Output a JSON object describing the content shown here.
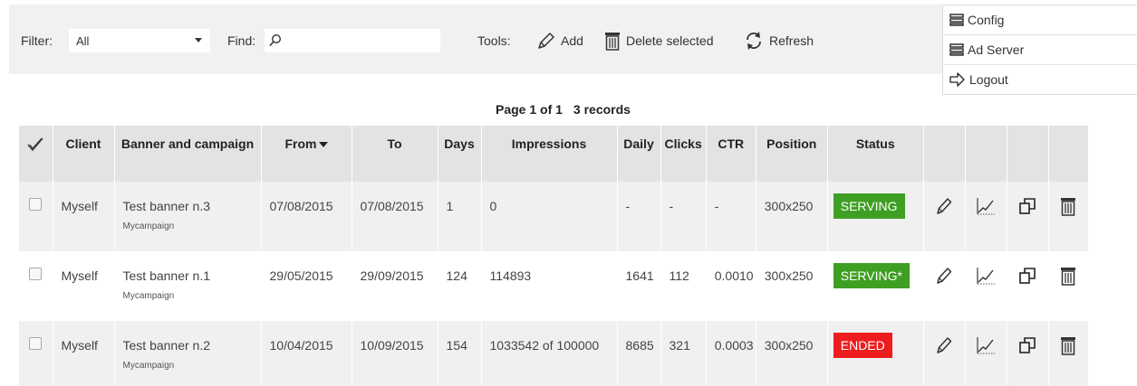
{
  "toolbar": {
    "filter_label": "Filter:",
    "filter_value": "All",
    "find_label": "Find:",
    "find_value": "",
    "tools_label": "Tools:",
    "add_label": "Add",
    "delete_label": "Delete selected",
    "refresh_label": "Refresh"
  },
  "menu": {
    "items": [
      {
        "label": "Config",
        "icon": "list-icon"
      },
      {
        "label": "Ad Server",
        "icon": "list-icon"
      },
      {
        "label": "Logout",
        "icon": "logout-arrow-icon"
      }
    ]
  },
  "pagination": {
    "page": "Page 1 of 1",
    "records": "3 records"
  },
  "table": {
    "headers": {
      "client": "Client",
      "banner": "Banner and campaign",
      "from": "From",
      "to": "To",
      "days": "Days",
      "impressions": "Impressions",
      "daily": "Daily",
      "clicks": "Clicks",
      "ctr": "CTR",
      "position": "Position",
      "status": "Status"
    },
    "rows": [
      {
        "client": "Myself",
        "banner": "Test banner n.3",
        "campaign": "Mycampaign",
        "from": "07/08/2015",
        "to": "07/08/2015",
        "days": "1",
        "impressions": "0",
        "daily": "-",
        "clicks": "-",
        "ctr": "-",
        "position": "300x250",
        "status": "SERVING",
        "status_color": "#3f9f23"
      },
      {
        "client": "Myself",
        "banner": "Test banner n.1",
        "campaign": "Mycampaign",
        "from": "29/05/2015",
        "to": "29/09/2015",
        "days": "124",
        "impressions": "114893",
        "daily": "1641",
        "clicks": "112",
        "ctr": "0.0010",
        "position": "300x250",
        "status": "SERVING*",
        "status_color": "#3f9f23"
      },
      {
        "client": "Myself",
        "banner": "Test banner n.2",
        "campaign": "Mycampaign",
        "from": "10/04/2015",
        "to": "10/09/2015",
        "days": "154",
        "impressions": "1033542 of 100000",
        "daily": "8685",
        "clicks": "321",
        "ctr": "0.0003",
        "position": "300x250",
        "status": "ENDED",
        "status_color": "#ee1c1c"
      }
    ]
  }
}
